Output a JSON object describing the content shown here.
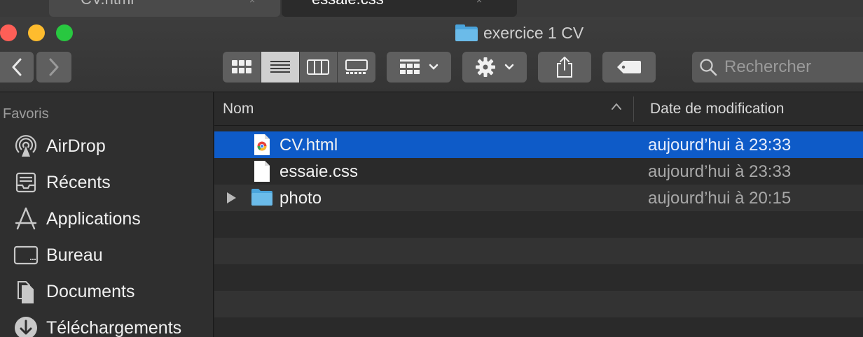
{
  "editor_tabs": [
    {
      "label": "CV.html",
      "active": false
    },
    {
      "label": "essaie.css",
      "active": true
    }
  ],
  "window": {
    "title": "exercice 1 CV"
  },
  "toolbar": {
    "back_icon": "chevron-left-icon",
    "forward_icon": "chevron-right-icon",
    "view_modes": [
      "icon-view",
      "list-view",
      "column-view",
      "gallery-view"
    ],
    "active_view": "list-view",
    "group_icon": "group-grid-icon",
    "action_icon": "gear-icon",
    "share_icon": "share-icon",
    "tag_icon": "tag-icon",
    "search_placeholder": "Rechercher"
  },
  "sidebar": {
    "heading": "Favoris",
    "items": [
      {
        "label": "AirDrop",
        "icon": "airdrop-icon"
      },
      {
        "label": "Récents",
        "icon": "recents-icon"
      },
      {
        "label": "Applications",
        "icon": "applications-icon"
      },
      {
        "label": "Bureau",
        "icon": "desktop-icon"
      },
      {
        "label": "Documents",
        "icon": "documents-icon"
      },
      {
        "label": "Téléchargements",
        "icon": "downloads-icon"
      }
    ]
  },
  "columns": {
    "name": "Nom",
    "date": "Date de modification"
  },
  "files": [
    {
      "name": "CV.html",
      "date": "aujourd’hui à 23:33",
      "kind": "html",
      "selected": true
    },
    {
      "name": "essaie.css",
      "date": "aujourd’hui à 23:33",
      "kind": "css",
      "selected": false
    },
    {
      "name": "photo",
      "date": "aujourd’hui à 20:15",
      "kind": "folder",
      "selected": false
    }
  ],
  "colors": {
    "selection": "#0e5bc8",
    "folder": "#5fb3e6"
  }
}
